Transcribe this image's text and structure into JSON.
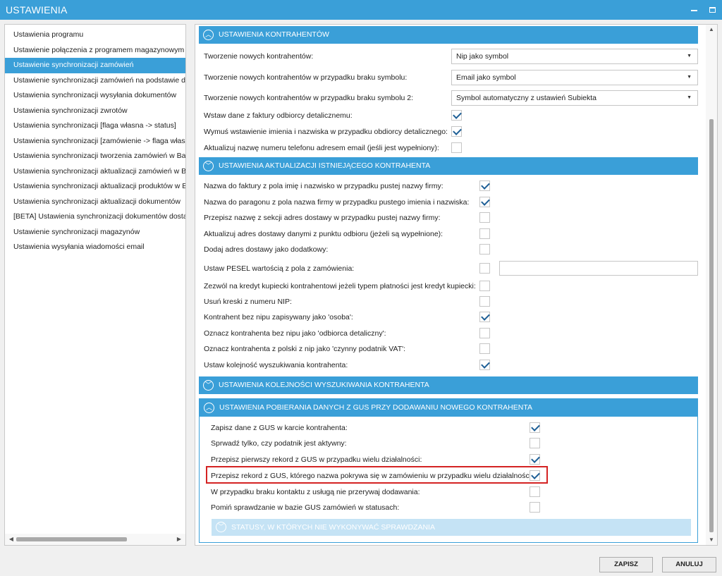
{
  "window": {
    "title": "USTAWIENIA",
    "minimize_icon": "minimize-icon",
    "maximize_icon": "maximize-icon"
  },
  "sidebar": {
    "items": [
      {
        "label": "Ustawienia programu"
      },
      {
        "label": "Ustawienie połączenia z programem magazynowym"
      },
      {
        "label": "Ustawienie synchronizacji zamówień",
        "selected": true
      },
      {
        "label": "Ustawienie synchronizacji zamówień na podstawie dzi"
      },
      {
        "label": "Ustawienia synchronizacji wysyłania dokumentów"
      },
      {
        "label": "Ustawienia synchronizacji zwrotów"
      },
      {
        "label": "Ustawienia synchronizacji [flaga własna -> status]"
      },
      {
        "label": "Ustawienia synchronizacji [zamówienie -> flaga własn"
      },
      {
        "label": "Ustawienia synchronizacji tworzenia zamówień w Base"
      },
      {
        "label": "Ustawienia synchronizacji aktualizacji zamówień w Bas"
      },
      {
        "label": "Ustawienia synchronizacji aktualizacji produktów w Ba"
      },
      {
        "label": "Ustawienia synchronizacji aktualizacji dokumentów"
      },
      {
        "label": "[BETA] Ustawienia synchronizacji dokumentów dostaw"
      },
      {
        "label": "Ustawienie synchronizacji magazynów"
      },
      {
        "label": "Ustawienia wysyłania wiadomości email"
      }
    ]
  },
  "sections": {
    "kontrahenci": {
      "header": "USTAWIENIA KONTRAHENTÓW",
      "rows": [
        {
          "label": "Tworzenie nowych kontrahentów:",
          "value": "Nip jako symbol"
        },
        {
          "label": "Tworzenie nowych kontrahentów w przypadku braku symbolu:",
          "value": "Email jako symbol"
        },
        {
          "label": "Tworzenie nowych kontrahentów w przypadku braku symbolu 2:",
          "value": "Symbol automatyczny z ustawień Subiekta"
        },
        {
          "label": "Wstaw dane z faktury odbiorcy detalicznemu:",
          "checked": true
        },
        {
          "label": "Wymuś wstawienie imienia i nazwiska w przypadku obdiorcy detalicznego:",
          "checked": true
        },
        {
          "label": "Aktualizuj nazwę numeru telefonu adresem email (jeśli jest wypełniony):",
          "checked": false
        }
      ]
    },
    "aktualizacja": {
      "header": "USTAWIENIA AKTUALIZACJI ISTNIEJĄCEGO KONTRAHENTA",
      "rows": [
        {
          "label": "Nazwa do faktury z pola imię i nazwisko w przypadku pustej nazwy firmy:",
          "checked": true
        },
        {
          "label": "Nazwa do paragonu z pola nazwa firmy w przypadku pustego imienia i nazwiska:",
          "checked": true
        },
        {
          "label": "Przepisz nazwę z sekcji adres dostawy w przypadku pustej nazwy firmy:",
          "checked": false
        },
        {
          "label": "Aktualizuj adres dostawy danymi z punktu odbioru (jeżeli są wypełnione):",
          "checked": false
        },
        {
          "label": "Dodaj adres dostawy jako dodatkowy:",
          "checked": false
        },
        {
          "label": "Ustaw PESEL wartością z pola z zamówienia:",
          "checked": false,
          "text_value": ""
        },
        {
          "label": "Zezwól na kredyt kupiecki kontrahentowi jeżeli typem płatności jest kredyt kupiecki:",
          "checked": false
        },
        {
          "label": "Usuń kreski z numeru NIP:",
          "checked": false
        },
        {
          "label": "Kontrahent bez nipu zapisywany jako 'osoba':",
          "checked": true
        },
        {
          "label": "Oznacz kontrahenta bez nipu jako 'odbiorca detaliczny':",
          "checked": false
        },
        {
          "label": "Oznacz kontrahenta z polski z nip jako 'czynny podatnik VAT':",
          "checked": false
        },
        {
          "label": "Ustaw kolejność wyszukiwania kontrahenta:",
          "checked": true
        }
      ]
    },
    "kolejnosc": {
      "header": "USTAWIENIA KOLEJNOŚCI WYSZUKIWANIA KONTRAHENTA"
    },
    "gus": {
      "header": "USTAWIENIA POBIERANIA DANYCH Z GUS PRZY DODAWANIU NOWEGO KONTRAHENTA",
      "rows": [
        {
          "label": "Zapisz dane z GUS w karcie kontrahenta:",
          "checked": true
        },
        {
          "label": "Sprwadź tylko, czy podatnik jest aktywny:",
          "checked": false
        },
        {
          "label": "Przepisz pierwszy rekord z GUS w przypadku wielu działalności:",
          "checked": true
        },
        {
          "label": "Przepisz rekord z GUS, którego nazwa pokrywa się w zamówieniu w przypadku wielu działalności:",
          "checked": true,
          "highlighted": true
        },
        {
          "label": "W przypadku braku kontaktu z usługą nie przerywaj dodawania:",
          "checked": false
        },
        {
          "label": "Pomiń sprawdzanie w bazie GUS zamówień w statusach:",
          "checked": false
        }
      ],
      "subheader": "STATUSY, W KTÓRYCH NIE WYKONYWAĆ SPRAWDZANIA"
    }
  },
  "buttons": {
    "save": "ZAPISZ",
    "cancel": "ANULUJ"
  },
  "colors": {
    "accent": "#3a9fd8",
    "highlight": "#d42323"
  }
}
